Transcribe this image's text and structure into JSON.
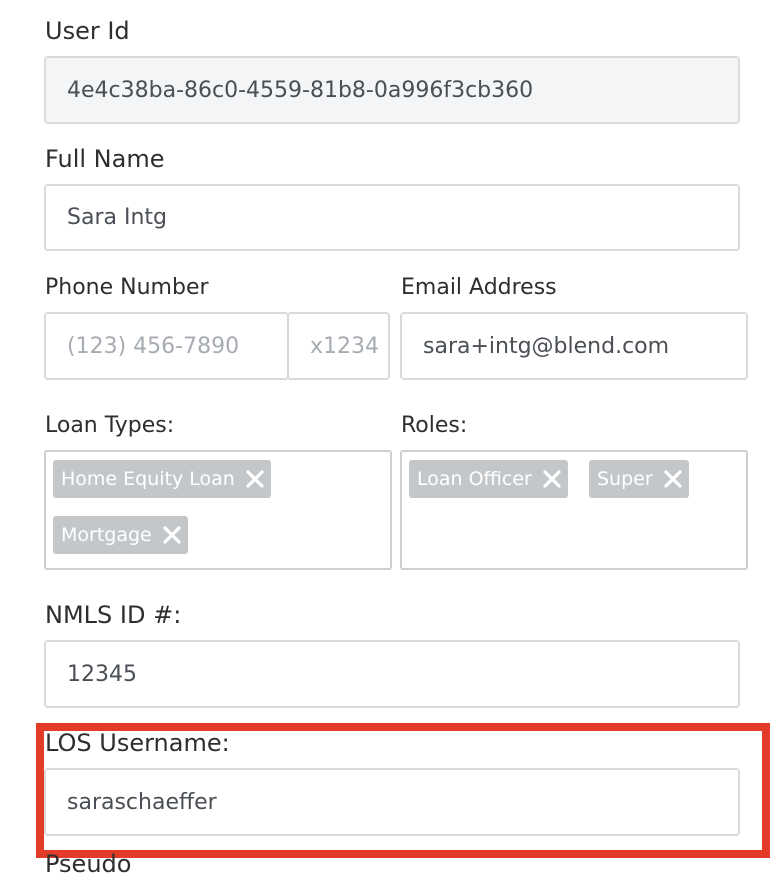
{
  "user_id": {
    "label": "User Id",
    "value": "4e4c38ba-86c0-4559-81b8-0a996f3cb360"
  },
  "full_name": {
    "label": "Full Name",
    "value": "Sara Intg"
  },
  "phone": {
    "label": "Phone Number",
    "placeholder": "(123) 456-7890",
    "ext_placeholder": "x1234"
  },
  "email": {
    "label": "Email Address",
    "value": "sara+intg@blend.com"
  },
  "loan_types": {
    "label": "Loan Types:",
    "tags": [
      "Home Equity Loan",
      "Mortgage"
    ]
  },
  "roles": {
    "label": "Roles:",
    "tags": [
      "Loan Officer",
      "Super"
    ]
  },
  "nmls": {
    "label": "NMLS ID #:",
    "value": "12345"
  },
  "los_username": {
    "label": "LOS Username:",
    "value": "saraschaeffer"
  },
  "next_label_partial": "Pseudo",
  "colors": {
    "highlight": "#e23c28",
    "tag_bg": "#c4c7ca",
    "readonly_bg": "#f4f5f6"
  }
}
